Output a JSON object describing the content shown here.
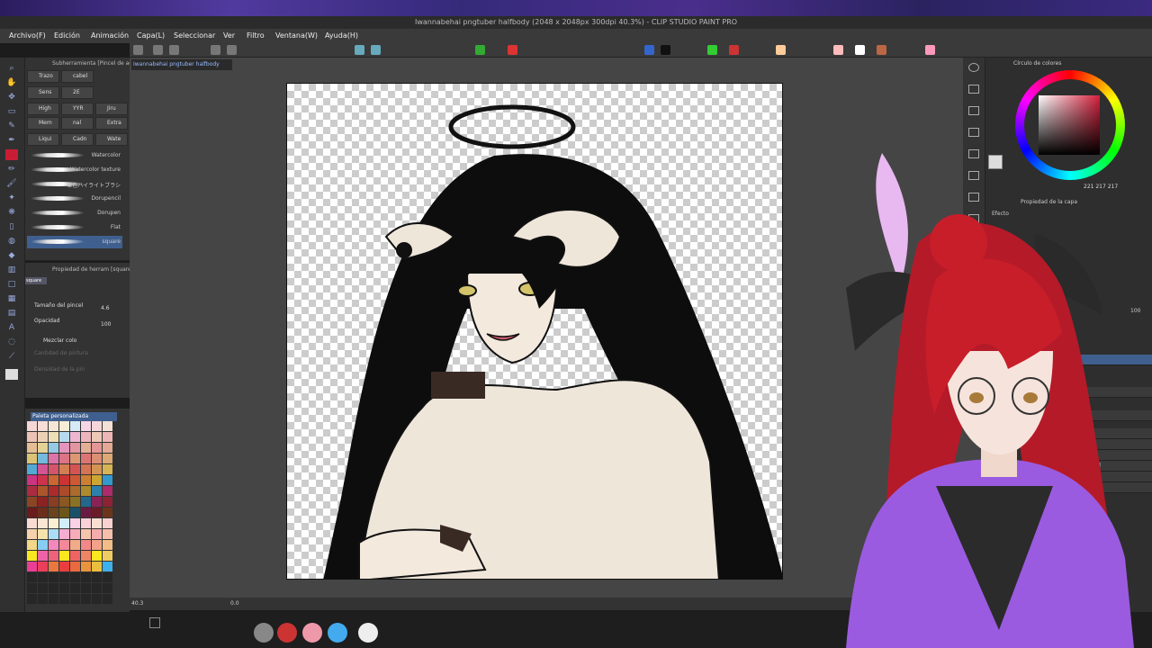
{
  "window": {
    "title": "Iwannabehai pngtuber halfbody (2048 x 2048px 300dpi 40.3%) - CLIP STUDIO PAINT PRO"
  },
  "menu": {
    "items": [
      "Archivo(F)",
      "Edición",
      "Animación",
      "Capa(L)",
      "Seleccionar",
      "Ver",
      "Filtro",
      "Ventana(W)",
      "Ayuda(H)"
    ]
  },
  "document_tab": "Iwannabehai pngtuber halfbody",
  "subtool_panel": {
    "title": "Subherramienta [Pincel de aguada]",
    "tabs": [
      "Trazo",
      "cabel",
      "Sens",
      "2E",
      "High",
      "YYR",
      "Jiru",
      "Mem",
      "nal",
      "Extra",
      "Liqui",
      "Cadn",
      "Wate"
    ],
    "brushes": [
      "Watercolor",
      "Watercolor texture",
      "筆色ハイライトブラシ",
      "Dorupencil",
      "Dorupen",
      "Flat",
      "square"
    ]
  },
  "tool_property": {
    "title": "Propiedad de herram [square]",
    "preset_name": "square",
    "brush_size_label": "Tamaño del pincel",
    "brush_size_value": "4.6",
    "opacity_label": "Opacidad",
    "opacity_value": "100",
    "mix_color_label": "Mezclar colo",
    "paint_amount_label": "Cantidad de pintura",
    "paint_density_label": "Densidad de la pin"
  },
  "palette": {
    "title": "Paleta personalizada"
  },
  "status": {
    "zoom": "40.3",
    "angle": "0.0"
  },
  "color_panel": {
    "title": "Círculo de colores",
    "rgb": "221 217 217",
    "current_color": "#c91d35",
    "sub_color": "#dddddd"
  },
  "layer_panel": {
    "tab_label": "Propiedad de la capa",
    "effect_label": "Efecto",
    "opacity_value": "100",
    "rows": [
      "Normal",
      "Normal",
      "Normal",
      "Normal",
      "Capa 7",
      "00 % Normal",
      "Carpeta 6",
      "Normal"
    ]
  },
  "colors": {
    "accent": "#3f5f8f",
    "brand_purple": "#5a3ea8",
    "hair_red": "#c81e2a",
    "outfit_purple": "#9b5be0"
  }
}
